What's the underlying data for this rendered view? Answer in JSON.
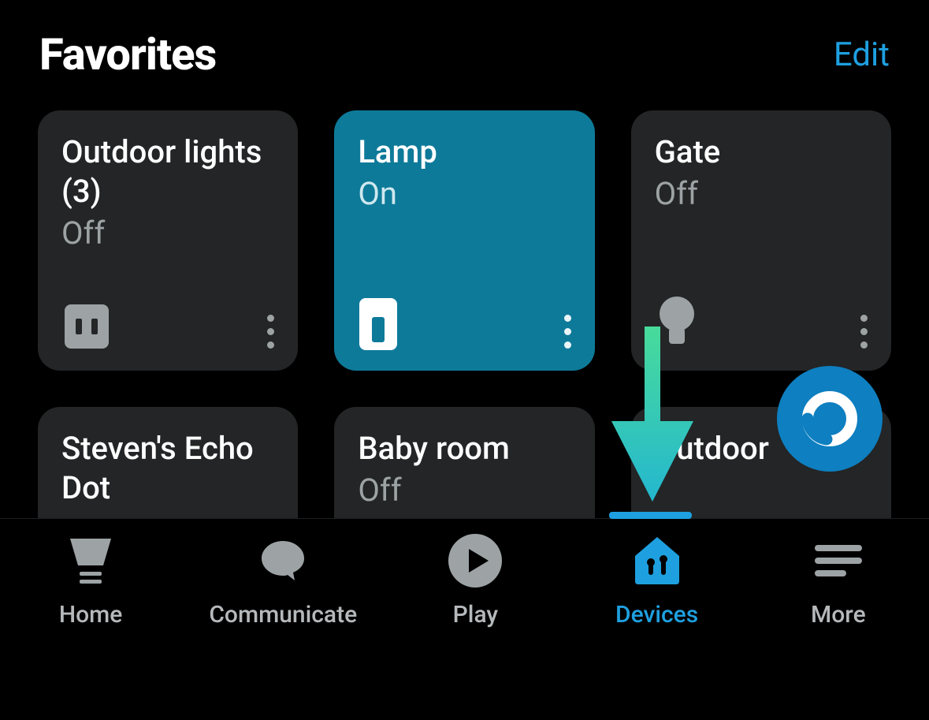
{
  "header": {
    "title": "Favorites",
    "edit": "Edit"
  },
  "cards": [
    {
      "name": "Outdoor lights (3)",
      "state": "Off",
      "icon": "plug-icon",
      "on": false
    },
    {
      "name": "Lamp",
      "state": "On",
      "icon": "switch-icon",
      "on": true
    },
    {
      "name": "Gate",
      "state": "Off",
      "icon": "bulb-icon",
      "on": false
    },
    {
      "name": "Steven's Echo Dot",
      "state": "",
      "icon": "",
      "on": false
    },
    {
      "name": "Baby room",
      "state": "Off",
      "icon": "",
      "on": false
    },
    {
      "name": "Outdoor",
      "state": "",
      "icon": "",
      "on": false
    }
  ],
  "tabs": [
    {
      "id": "home",
      "label": "Home",
      "icon": "home-icon",
      "active": false
    },
    {
      "id": "communicate",
      "label": "Communicate",
      "icon": "chat-icon",
      "active": false
    },
    {
      "id": "play",
      "label": "Play",
      "icon": "play-icon",
      "active": false
    },
    {
      "id": "devices",
      "label": "Devices",
      "icon": "devices-icon",
      "active": true
    },
    {
      "id": "more",
      "label": "More",
      "icon": "more-icon",
      "active": false
    }
  ],
  "colors": {
    "accent": "#1ea0e0",
    "card_bg": "#232526",
    "card_on_bg": "#0e7a99",
    "muted": "#9da3a5",
    "fab": "#0e7fc0",
    "arrow_top": "#48db9b",
    "arrow_bottom": "#24b7cf"
  }
}
